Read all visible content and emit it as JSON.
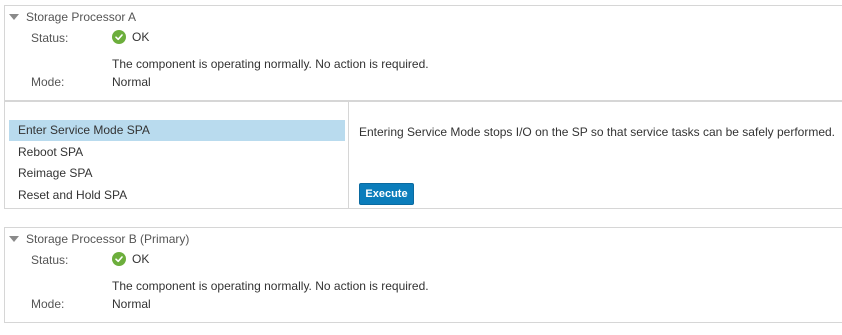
{
  "sp_a": {
    "title": "Storage Processor A",
    "status_label": "Status:",
    "status_value": "OK",
    "status_message": "The component is operating normally. No action is required.",
    "mode_label": "Mode:",
    "mode_value": "Normal"
  },
  "actions": {
    "items": [
      {
        "label": "Enter Service Mode SPA",
        "selected": true
      },
      {
        "label": "Reboot SPA",
        "selected": false
      },
      {
        "label": "Reimage SPA",
        "selected": false
      },
      {
        "label": "Reset and Hold SPA",
        "selected": false
      }
    ],
    "description": "Entering Service Mode stops I/O on the SP so that service tasks can be safely performed.",
    "execute_label": "Execute"
  },
  "sp_b": {
    "title": "Storage Processor B (Primary)",
    "status_label": "Status:",
    "status_value": "OK",
    "status_message": "The component is operating normally. No action is required.",
    "mode_label": "Mode:",
    "mode_value": "Normal"
  },
  "icons": {
    "collapse": "chevron-down-icon",
    "status_ok": "check-circle-icon"
  },
  "colors": {
    "selected_row": "#b9dbee",
    "execute_button": "#0b7dbb",
    "ok_green": "#6cae3c"
  }
}
